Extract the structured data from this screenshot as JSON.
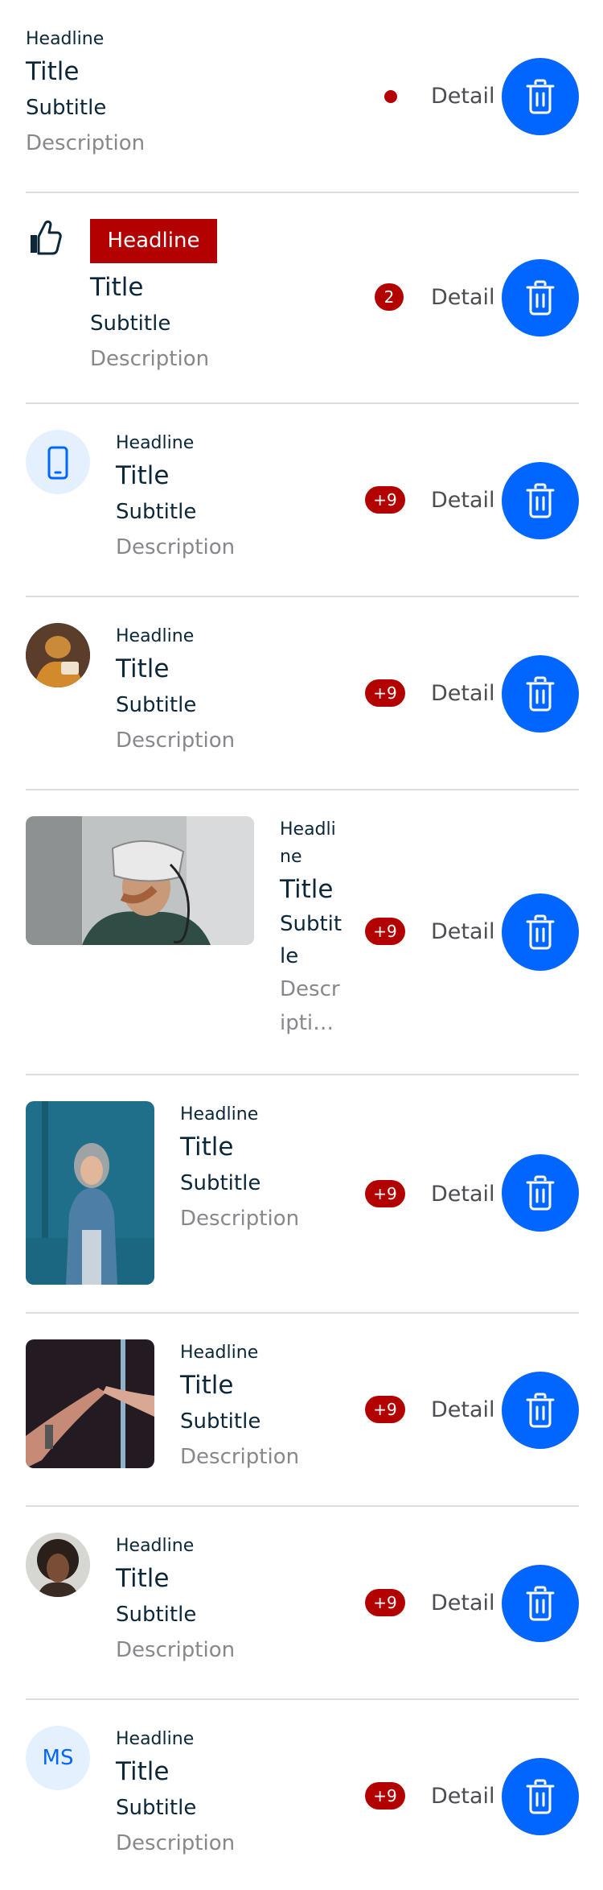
{
  "colors": {
    "accent": "#0066ff",
    "badge": "#b30000",
    "divider": "#dddddd",
    "text_primary": "#0b2739",
    "text_secondary": "#86888c",
    "avatar_bg": "#e5f0ff"
  },
  "rows": [
    {
      "headline": "Headline",
      "title": "Title",
      "subtitle": "Subtitle",
      "description": "Description",
      "detail": "Detail",
      "badge": "",
      "trash_icon": "trash-icon"
    },
    {
      "headline": "Headline",
      "title": "Title",
      "subtitle": "Subtitle",
      "description": "Description",
      "detail": "Detail",
      "badge": "2",
      "leading_icon": "thumbs-up-icon",
      "trash_icon": "trash-icon"
    },
    {
      "headline": "Headline",
      "title": "Title",
      "subtitle": "Subtitle",
      "description": "Description",
      "detail": "Detail",
      "badge": "+9",
      "leading_icon": "mobile-phone-icon",
      "trash_icon": "trash-icon"
    },
    {
      "headline": "Headline",
      "title": "Title",
      "subtitle": "Subtitle",
      "description": "Description",
      "detail": "Detail",
      "badge": "+9",
      "leading_media": "circular-photo",
      "trash_icon": "trash-icon"
    },
    {
      "headline": "Headline",
      "title": "Title",
      "subtitle": "Subtitle",
      "description": "Descripti…",
      "detail": "Detail",
      "badge": "+9",
      "leading_media": "wide-photo",
      "trash_icon": "trash-icon"
    },
    {
      "headline": "Headline",
      "title": "Title",
      "subtitle": "Subtitle",
      "description": "Description",
      "detail": "Detail",
      "badge": "+9",
      "leading_media": "portrait-photo",
      "trash_icon": "trash-icon"
    },
    {
      "headline": "Headline",
      "title": "Title",
      "subtitle": "Subtitle",
      "description": "Description",
      "detail": "Detail",
      "badge": "+9",
      "leading_media": "square-photo",
      "trash_icon": "trash-icon"
    },
    {
      "headline": "Headline",
      "title": "Title",
      "subtitle": "Subtitle",
      "description": "Description",
      "detail": "Detail",
      "badge": "+9",
      "leading_media": "avatar-photo",
      "trash_icon": "trash-icon"
    },
    {
      "headline": "Headline",
      "title": "Title",
      "subtitle": "Subtitle",
      "description": "Description",
      "detail": "Detail",
      "badge": "+9",
      "avatar_initials": "MS",
      "trash_icon": "trash-icon"
    }
  ]
}
